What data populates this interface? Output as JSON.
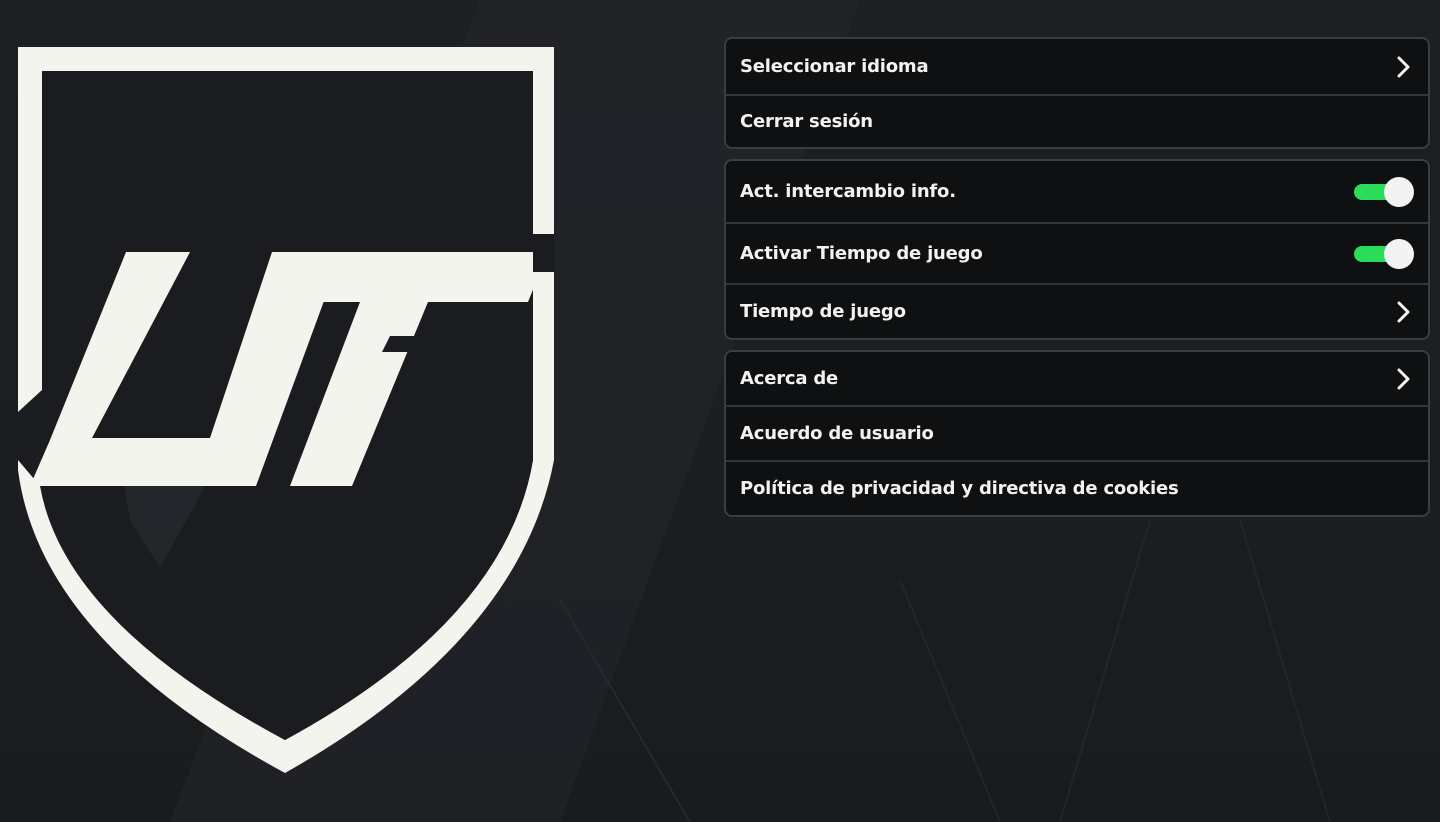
{
  "logo": {
    "text": "UT"
  },
  "groups": [
    {
      "items": [
        {
          "label": "Seleccionar idioma",
          "control": "chevron-right-icon"
        },
        {
          "label": "Cerrar sesión",
          "control": "none"
        }
      ]
    },
    {
      "items": [
        {
          "label": "Act. intercambio info.",
          "control": "toggle",
          "on": true
        },
        {
          "label": "Activar Tiempo de juego",
          "control": "toggle",
          "on": true
        },
        {
          "label": "Tiempo de juego",
          "control": "chevron-right-icon"
        }
      ]
    },
    {
      "items": [
        {
          "label": "Acerca de",
          "control": "chevron-right-icon"
        },
        {
          "label": "Acuerdo de usuario",
          "control": "none"
        },
        {
          "label": "Política de privacidad y directiva de cookies",
          "control": "none"
        }
      ]
    }
  ],
  "colors": {
    "background": "#1b1d20",
    "panel": "#0f1011",
    "toggle_on": "#2bdc5a",
    "logo": "#f4f4ee"
  }
}
